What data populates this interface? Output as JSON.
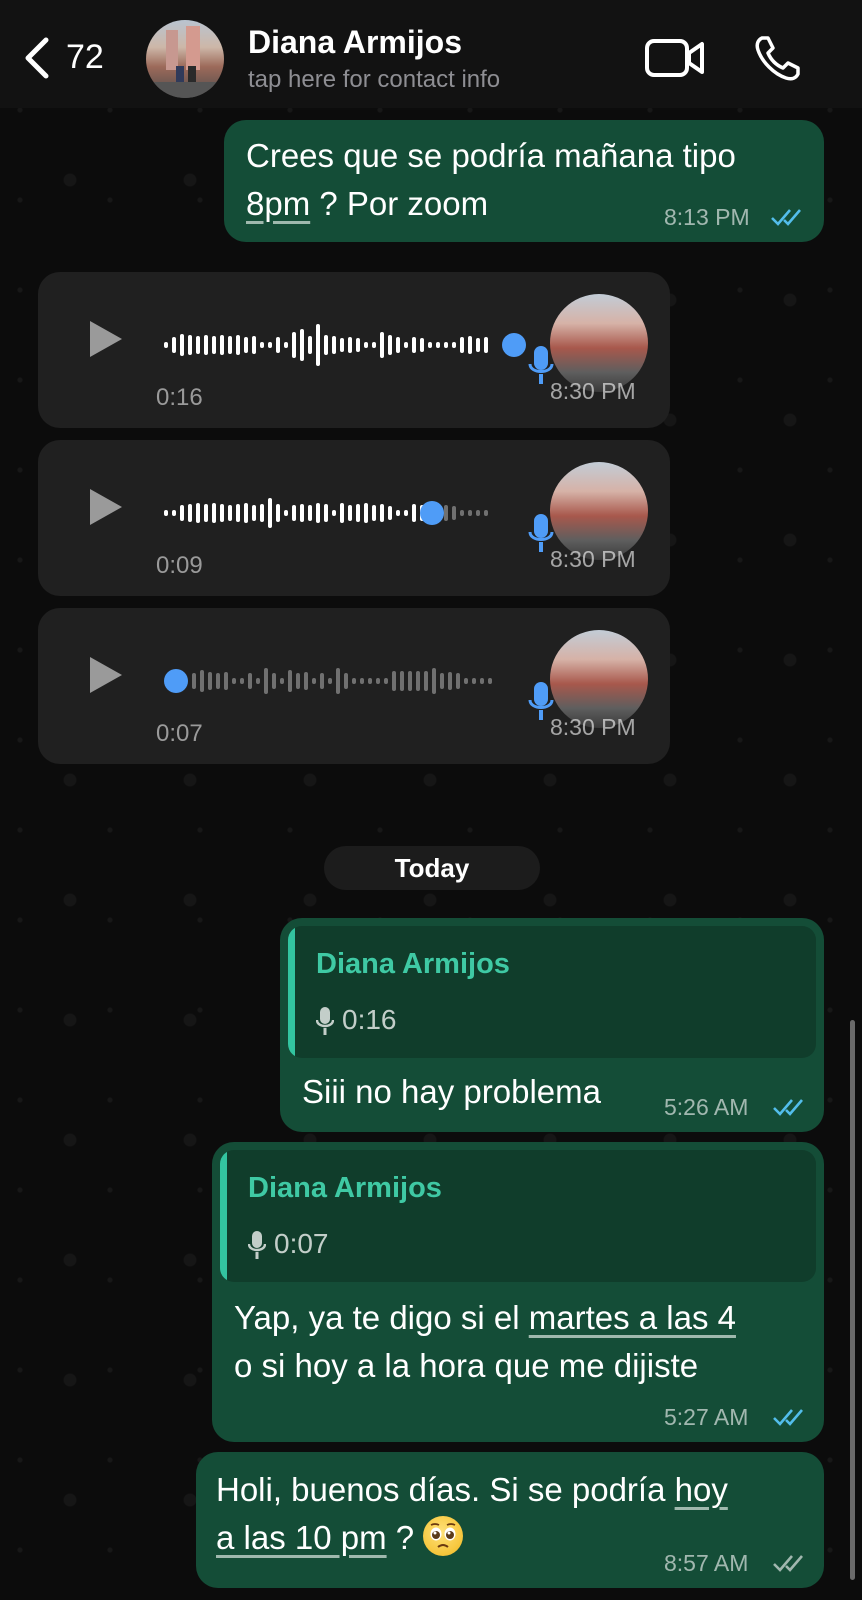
{
  "header": {
    "back_count": "72",
    "contact_name": "Diana Armijos",
    "contact_subtitle": "tap here for contact info"
  },
  "messages": [
    {
      "type": "text",
      "direction": "outgoing",
      "text_line1": "Crees que se podría mañana tipo",
      "text_link": "8pm",
      "text_rest": " ? Por zoom",
      "time": "8:13 PM",
      "status": "read"
    },
    {
      "type": "voice",
      "direction": "incoming",
      "duration": "0:16",
      "time": "8:30 PM",
      "progress": 0.92
    },
    {
      "type": "voice",
      "direction": "incoming",
      "duration": "0:09",
      "time": "8:30 PM",
      "progress": 0.79
    },
    {
      "type": "voice",
      "direction": "incoming",
      "duration": "0:07",
      "time": "8:30 PM",
      "progress": 0.0
    }
  ],
  "day_separator": "Today",
  "replies": [
    {
      "quote_name": "Diana Armijos",
      "quote_duration": "0:16",
      "text": "Siii no hay problema",
      "time": "5:26 AM",
      "status": "read"
    },
    {
      "quote_name": "Diana Armijos",
      "quote_duration": "0:07",
      "text_pre": "Yap, ya te digo si el ",
      "text_link": "martes a las 4",
      "text_line2": "o si hoy a la hora que me dijiste",
      "time": "5:27 AM",
      "status": "read"
    }
  ],
  "last_message": {
    "text_line1_pre": "Holi,  buenos días. Si se podría ",
    "text_link_1": "hoy",
    "text_link_2": "a las 10 pm",
    "text_rest": " ? ",
    "emoji": "pleading-face",
    "time": "8:57 AM",
    "status": "delivered"
  },
  "colors": {
    "outgoing_bubble": "#144d37",
    "incoming_bubble": "#202020",
    "read_tick": "#53bdeb",
    "accent_green": "#3fc9a4",
    "voice_dot": "#4f9cf7"
  }
}
